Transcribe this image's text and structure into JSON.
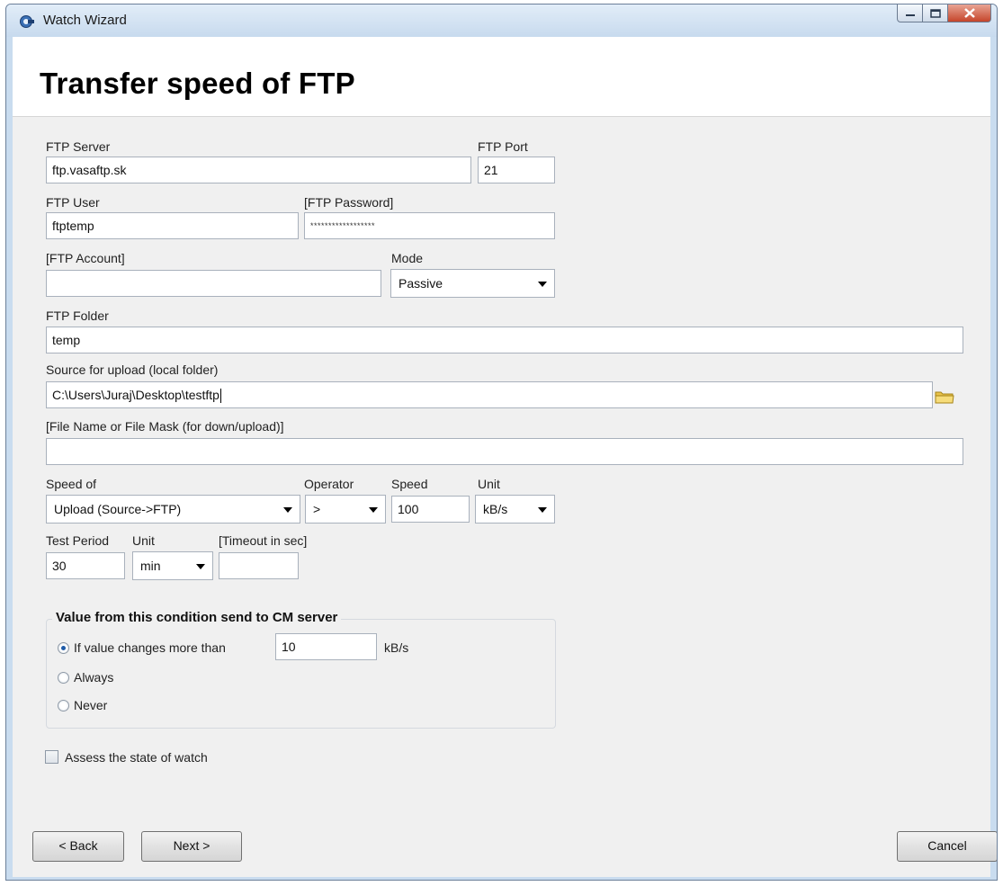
{
  "window": {
    "title": "Watch Wizard"
  },
  "header": {
    "title": "Transfer speed of FTP"
  },
  "form": {
    "ftp_server_label": "FTP Server",
    "ftp_server_value": "ftp.vasaftp.sk",
    "ftp_port_label": "FTP Port",
    "ftp_port_value": "21",
    "ftp_user_label": "FTP User",
    "ftp_user_value": "ftptemp",
    "ftp_password_label": "[FTP Password]",
    "ftp_password_value": "******************",
    "ftp_account_label": "[FTP Account]",
    "ftp_account_value": "",
    "mode_label": "Mode",
    "mode_value": "Passive",
    "ftp_folder_label": "FTP Folder",
    "ftp_folder_value": "temp",
    "source_label": "Source for upload (local folder)",
    "source_value": "C:\\Users\\Juraj\\Desktop\\testftp",
    "file_mask_label": "[File Name or File Mask (for down/upload)]",
    "file_mask_value": "",
    "speed_of_label": "Speed of",
    "speed_of_value": "Upload (Source->FTP)",
    "operator_label": "Operator",
    "operator_value": ">",
    "speed_label": "Speed",
    "speed_value": "100",
    "unit_label": "Unit",
    "unit_value": "kB/s",
    "test_period_label": "Test Period",
    "test_period_value": "30",
    "period_unit_label": "Unit",
    "period_unit_value": "min",
    "timeout_label": "[Timeout in sec]",
    "timeout_value": ""
  },
  "send_group": {
    "title": "Value from this condition send to CM server",
    "option_changes": "If value changes more than",
    "change_value": "10",
    "change_unit": "kB/s",
    "option_always": "Always",
    "option_never": "Never",
    "selected": "If value changes more than"
  },
  "assess": {
    "label": "Assess the state of watch",
    "checked": false
  },
  "buttons": {
    "back": "< Back",
    "next": "Next >",
    "cancel": "Cancel"
  },
  "colors": {
    "title_close": "#c5452b",
    "radio_selected": "#1e5ba8"
  }
}
